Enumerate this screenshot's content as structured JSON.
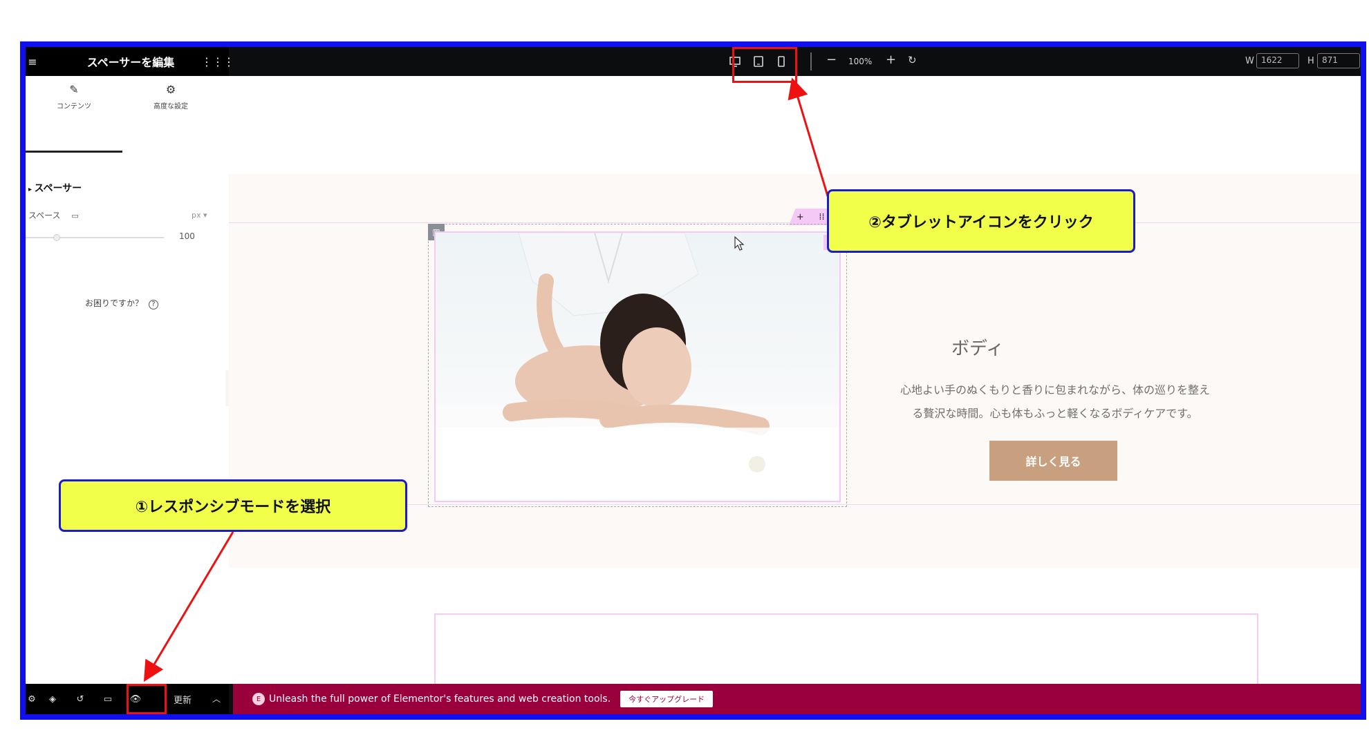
{
  "header": {
    "panel_title": "スペーサーを編集",
    "zoom": "100%",
    "width_label": "W",
    "width_value": "1622",
    "height_label": "H",
    "height_value": "871"
  },
  "sidebar": {
    "tabs": [
      {
        "label": "コンテンツ"
      },
      {
        "label": "高度な設定"
      }
    ],
    "section_title": "スペーサー",
    "control_label": "スペース",
    "unit": "px",
    "slider_value": "100",
    "help_text": "お困りですか？"
  },
  "content": {
    "heading": "ボディ",
    "desc_line1": "心地よい手のぬくもりと香りに包まれながら、体の巡りを整え",
    "desc_line2": "る贅沢な時間。心も体もふっと軽くなるボディケアです。",
    "cta_label": "詳しく見る"
  },
  "bottom_bar": {
    "update_label": "更新",
    "promo_text": "Unleash the full power of Elementor's features and web creation tools.",
    "upgrade_label": "今すぐアップグレード"
  },
  "annotations": {
    "callout1": "①レスポンシブモードを選択",
    "callout2": "②タブレットアイコンをクリック"
  },
  "colors": {
    "frame_border": "#1010ee",
    "promo_bg": "#9a003b",
    "cta_bg": "#c8a07f",
    "callout_bg": "#f2ff4a",
    "highlight_red": "#ee1111"
  }
}
